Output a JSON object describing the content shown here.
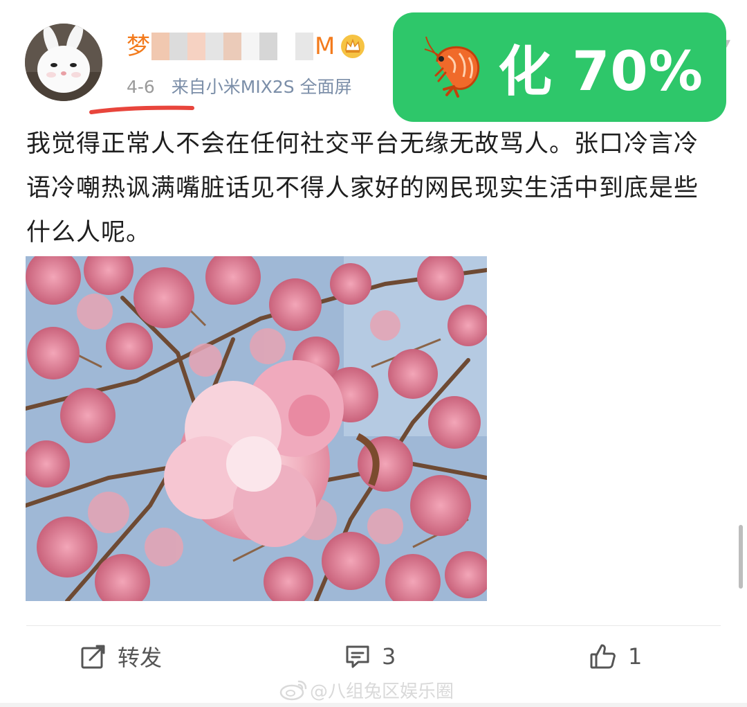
{
  "header": {
    "username_start": "梦",
    "username_end": "M",
    "date": "4-6",
    "source": "来自小米MIX2S 全面屏",
    "icons": {
      "avatar": "white-rabbit-avatar",
      "vip": "crown-icon",
      "menu": "chevron-down-icon"
    }
  },
  "badge": {
    "icon": "shrimp-icon",
    "text": "化 70%",
    "color": "#2ec76a"
  },
  "post": {
    "text": "我觉得正常人不会在任何社交平台无缘无故骂人。张口冷言冷语冷嘲热讽满嘴脏话见不得人家好的网民现实生活中到底是些什么人呢。",
    "image": "pink-cherry-blossom-photo"
  },
  "actions": {
    "repost_label": "转发",
    "comment_count": "3",
    "like_count": "1",
    "icons": {
      "repost": "repost-icon",
      "comment": "comment-icon",
      "like": "thumbs-up-icon"
    }
  },
  "watermark": {
    "text": "@八组兔区娱乐圈",
    "icon": "weibo-logo"
  },
  "colors": {
    "username": "#f37b1d",
    "meta": "#9a9a9a",
    "source": "#7b8ea8",
    "underline": "#e8453c"
  }
}
